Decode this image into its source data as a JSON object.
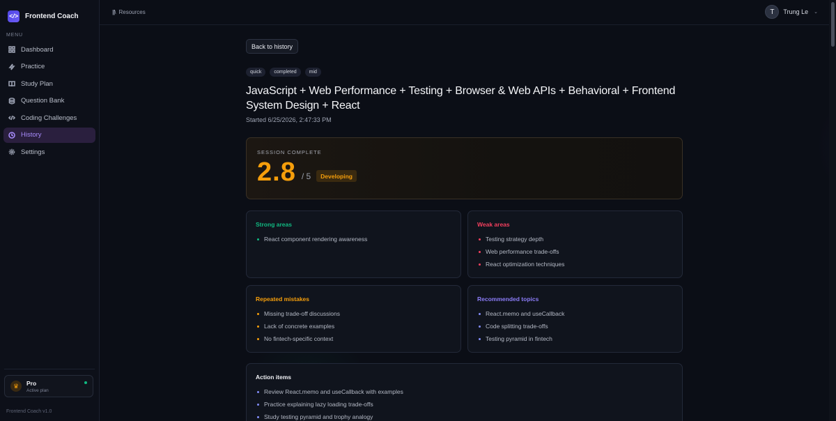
{
  "app": {
    "name": "Frontend Coach",
    "logo_text": "</>"
  },
  "sidebar": {
    "menu_label": "MENU",
    "items": [
      {
        "label": "Dashboard",
        "icon": "grid-icon"
      },
      {
        "label": "Practice",
        "icon": "bolt-icon"
      },
      {
        "label": "Study Plan",
        "icon": "book-icon"
      },
      {
        "label": "Question Bank",
        "icon": "database-icon"
      },
      {
        "label": "Coding Challenges",
        "icon": "code-icon"
      },
      {
        "label": "History",
        "icon": "clock-icon",
        "active": true
      },
      {
        "label": "Settings",
        "icon": "gear-icon"
      }
    ],
    "plan": {
      "title": "Pro",
      "subtitle": "Active plan"
    },
    "version": "Frontend Coach v1.0"
  },
  "header": {
    "breadcrumb": "Resources",
    "user": {
      "initial": "T",
      "name": "Trung Le"
    }
  },
  "session": {
    "back_label": "Back to history",
    "tags": [
      "quick",
      "completed",
      "mid"
    ],
    "title": "JavaScript + Web Performance + Testing + Browser & Web APIs + Behavioral + Frontend System Design + React",
    "started": "Started 6/25/2026, 2:47:33 PM",
    "score": {
      "label": "SESSION COMPLETE",
      "value": "2.8",
      "max": "/ 5",
      "level": "Developing"
    },
    "strong_areas": {
      "title": "Strong areas",
      "items": [
        "React component rendering awareness"
      ]
    },
    "weak_areas": {
      "title": "Weak areas",
      "items": [
        "Testing strategy depth",
        "Web performance trade-offs",
        "React optimization techniques"
      ]
    },
    "repeated_mistakes": {
      "title": "Repeated mistakes",
      "items": [
        "Missing trade-off discussions",
        "Lack of concrete examples",
        "No fintech-specific context"
      ]
    },
    "recommended_topics": {
      "title": "Recommended topics",
      "items": [
        "React.memo and useCallback",
        "Code splitting trade-offs",
        "Testing pyramid in fintech"
      ]
    },
    "action_items": {
      "title": "Action items",
      "items": [
        "Review React.memo and useCallback with examples",
        "Practice explaining lazy loading trade-offs",
        "Study testing pyramid and trophy analogy"
      ]
    }
  },
  "colors": {
    "accent": "#a78bfa",
    "score": "#f59e0b",
    "strong": "#10b981",
    "weak": "#f43f5e",
    "mistakes": "#f59e0b",
    "recommended": "#8b7cf6"
  }
}
